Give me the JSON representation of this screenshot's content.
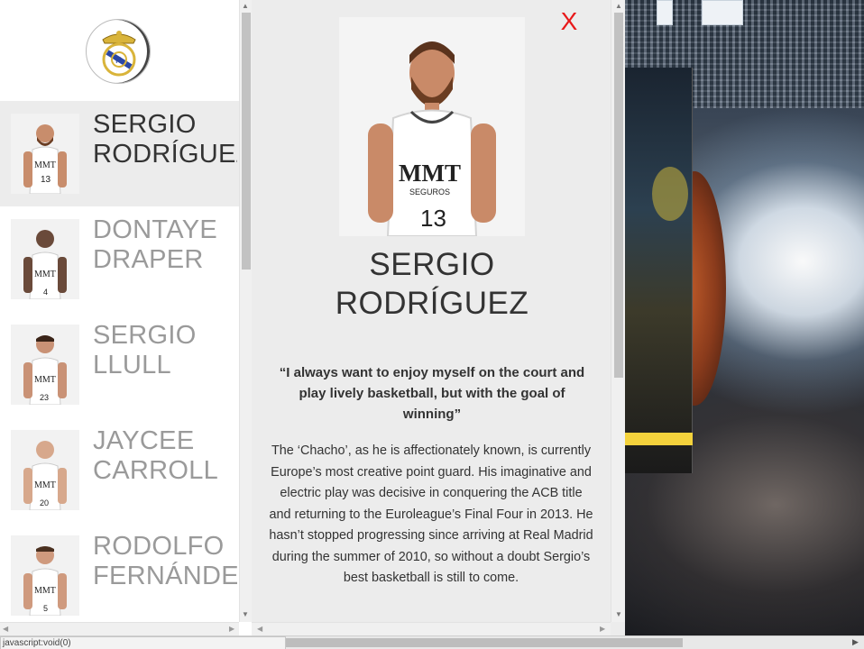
{
  "club": {
    "logo_icon": "real-madrid-crest-icon"
  },
  "players": [
    {
      "name": "SERGIO\nRODRÍGUEZ",
      "number": "13",
      "active": true
    },
    {
      "name": "DONTAYE\nDRAPER",
      "number": "4",
      "active": false
    },
    {
      "name": "SERGIO\nLLULL",
      "number": "23",
      "active": false
    },
    {
      "name": "JAYCEE\nCARROLL",
      "number": "20",
      "active": false
    },
    {
      "name": "RODOLFO\nFERNÁNDEZ",
      "number": "5",
      "active": false
    }
  ],
  "detail": {
    "close_label": "X",
    "name": "SERGIO\nRODRÍGUEZ",
    "jersey_sponsor": "MMT",
    "jersey_sub": "SEGUROS",
    "jersey_number": "13",
    "quote": "“I always want to enjoy myself on the court and play lively basketball, but with the goal of winning”",
    "bio": "The ‘Chacho’, as he is affectionately known, is currently Europe’s most creative point guard. His imaginative and electric play was decisive in conquering the ACB title and returning to the Euroleague’s Final Four in 2013. He hasn’t stopped progressing since arriving at Real Madrid during the summer of 2010, so without a doubt Sergio’s best basketball is still to come."
  },
  "statusbar": {
    "text": "javascript:void(0)"
  },
  "colors": {
    "close": "#e8191a",
    "active_row": "#ececec",
    "inactive_name": "#9a9a9a",
    "active_name": "#333333"
  }
}
